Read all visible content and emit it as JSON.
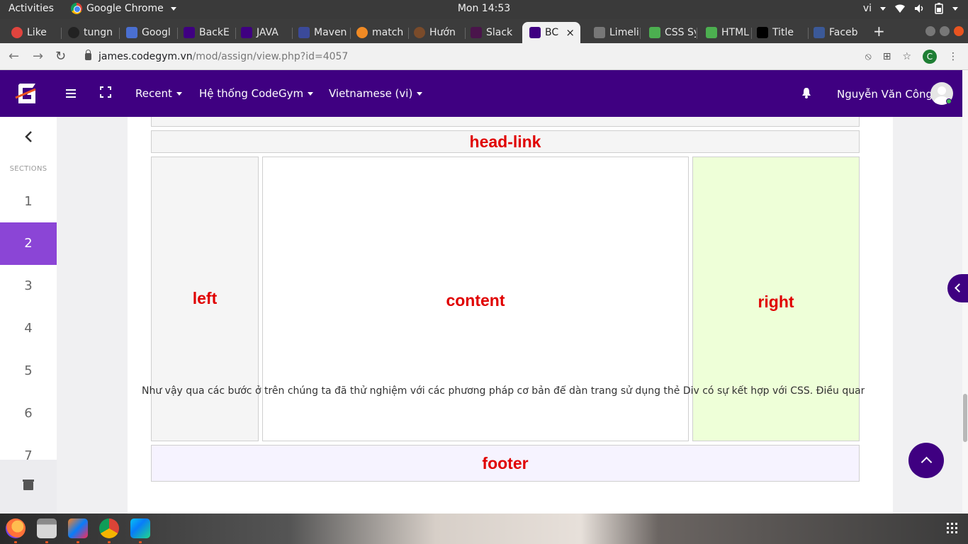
{
  "system": {
    "activities": "Activities",
    "app_name": "Google Chrome",
    "clock": "Mon 14:53",
    "lang": "vi"
  },
  "tabs": [
    {
      "label": "Like",
      "color": "#e0443e"
    },
    {
      "label": "tungn",
      "color": "#222222"
    },
    {
      "label": "Googl",
      "color": "#4a6fd1"
    },
    {
      "label": "BackE",
      "color": "#3f0081"
    },
    {
      "label": "JAVA",
      "color": "#3f0081"
    },
    {
      "label": "Maven",
      "color": "#3b4a9a"
    },
    {
      "label": "match",
      "color": "#f08a24"
    },
    {
      "label": "Hướn",
      "color": "#7a4b2a"
    },
    {
      "label": "Slack",
      "color": "#4a154b"
    },
    {
      "label": "BC",
      "color": "#3f0081"
    },
    {
      "label": "Limeli",
      "color": "#777777"
    },
    {
      "label": "CSS Sy",
      "color": "#4caf50"
    },
    {
      "label": "HTML",
      "color": "#4caf50"
    },
    {
      "label": "Title",
      "color": "#000000"
    },
    {
      "label": "Faceb",
      "color": "#3b5998"
    }
  ],
  "address": {
    "domain": "james.codegym.vn",
    "path": "/mod/assign/view.php?id=4057",
    "profile_initial": "C"
  },
  "header": {
    "menu_recent": "Recent",
    "menu_system": "Hệ thống CodeGym",
    "menu_language": "Vietnamese (vi)",
    "user_name": "Nguyễn Văn Công"
  },
  "sidebar": {
    "label": "SECTIONS",
    "items": [
      "1",
      "2",
      "3",
      "4",
      "5",
      "6",
      "7"
    ],
    "active": "2"
  },
  "layout_demo": {
    "head_link": "head-link",
    "left": "left",
    "content": "content",
    "right": "right",
    "footer": "footer"
  },
  "paragraph": "Như vậy qua các bước ở trên chúng ta đã thử nghiệm với các phương pháp cơ bản để dàn trang sử dụng thẻ Div có sự kết hợp với CSS. Điều quan",
  "colors": {
    "brand": "#3f0081",
    "active_section": "#8b45d6",
    "demo_text": "#e00000",
    "right_bg": "#eeffd8",
    "footer_bg": "#f6f3ff"
  },
  "dock": {
    "apps": [
      "firefox-icon",
      "files-icon",
      "intellij-icon",
      "chrome-icon",
      "webstorm-icon"
    ]
  }
}
